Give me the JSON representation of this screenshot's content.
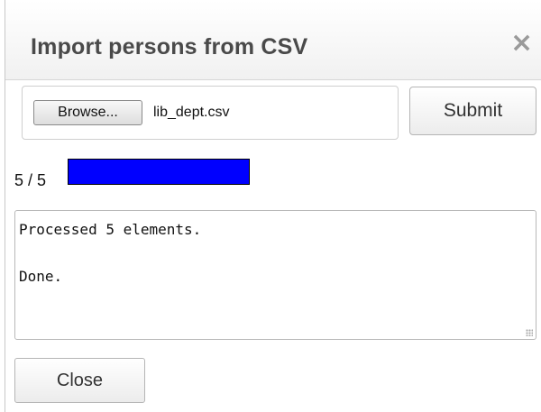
{
  "dialog": {
    "title": "Import persons from CSV",
    "close_icon": "×"
  },
  "file_input": {
    "browse_label": "Browse...",
    "file_name": "lib_dept.csv"
  },
  "submit_label": "Submit",
  "progress": {
    "label": "5 / 5",
    "processed": 5,
    "total": 5,
    "fraction": 1.0,
    "fill_color": "#0000ff"
  },
  "log": {
    "text": "Processed 5 elements.\n\nDone."
  },
  "footer": {
    "close_label": "Close"
  }
}
